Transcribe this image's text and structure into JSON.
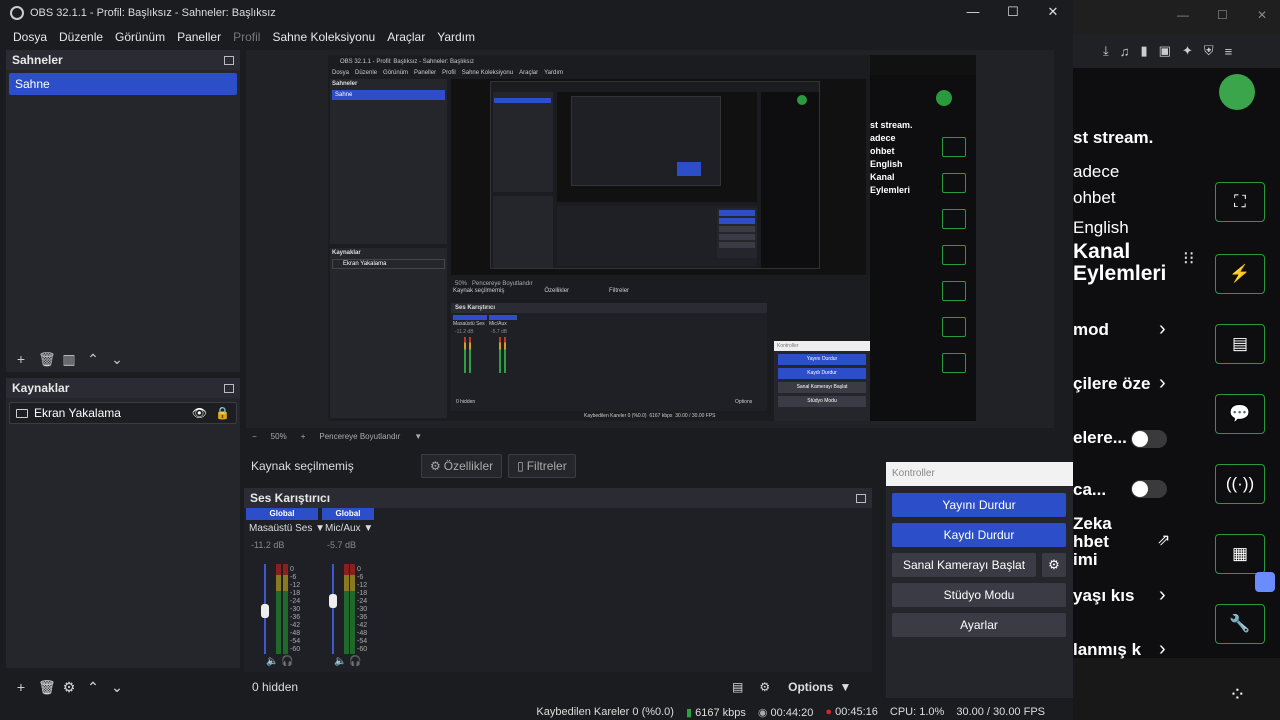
{
  "window": {
    "title": "OBS 32.1.1 - Profil: Başlıksız - Sahneler: Başlıksız",
    "min": "—",
    "max": "☐",
    "close": "✕"
  },
  "menu": [
    "Dosya",
    "Düzenle",
    "Görünüm",
    "Paneller",
    "Profil",
    "Sahne Koleksiyonu",
    "Araçlar",
    "Yardım"
  ],
  "scenes": {
    "title": "Sahneler",
    "items": [
      "Sahne"
    ]
  },
  "sources": {
    "title": "Kaynaklar",
    "items": [
      "Ekran Yakalama"
    ]
  },
  "preview": {
    "zoom": "50%",
    "fit_label": "Pencereye Boyutlandır",
    "capture_title": "OBS 32.1.1 - Profil: Başlıksız - Sahneler: Başlıksız",
    "capture_menu": [
      "Dosya",
      "Düzenle",
      "Görünüm",
      "Paneller",
      "Profil",
      "Sahne Koleksiyonu",
      "Araçlar",
      "Yardım"
    ],
    "capture_scenes": "Sahneler",
    "capture_scene": "Sahne",
    "capture_sources": "Kaynaklar",
    "capture_source": "Ekran Yakalama",
    "capture_nosel": "Kaynak seçilmemiş",
    "capture_props": "Özellikler",
    "capture_filters": "Filtreler",
    "capture_mixer": "Ses Karıştırıcı",
    "capture_controls": "Kontroller",
    "capture_ch1": "Masaüstü Ses",
    "capture_ch2": "Mic/Aux",
    "capture_db1": "-11.2 dB",
    "capture_db2": "-5.7 dB",
    "capture_hidden": "0 hidden",
    "capture_options": "Options",
    "capture_status": "Kaybedilen Kareler 0 (%0.0)",
    "capture_kbps": "6167 kbps",
    "capture_fps": "30.00 / 30.00 FPS",
    "capture_buttons": [
      "Yayını Durdur",
      "Kaydı Durdur",
      "Sanal Kamerayı Başlat",
      "Stüdyo Modu",
      "Ayarlar"
    ]
  },
  "source_toolbar": {
    "no_selection": "Kaynak seçilmemiş",
    "properties": "Özellikler",
    "filters": "Filtreler"
  },
  "mixer": {
    "title": "Ses Karıştırıcı",
    "channels": [
      {
        "badge": "Global",
        "name": "Masaüstü Ses",
        "db": "-11.2 dB",
        "level": 0.35
      },
      {
        "badge": "Global",
        "name": "Mic/Aux",
        "db": "-5.7 dB",
        "level": 0.5
      }
    ],
    "scale": [
      "0",
      "-6",
      "-12",
      "-18",
      "-24",
      "-30",
      "-36",
      "-42",
      "-48",
      "-54",
      "-60"
    ],
    "hidden": "0 hidden",
    "options": "Options"
  },
  "controls": {
    "title": "Kontroller",
    "buttons": [
      "Yayını Durdur",
      "Kaydı Durdur",
      "Sanal Kamerayı Başlat",
      "Stüdyo Modu",
      "Ayarlar"
    ]
  },
  "status": {
    "dropped": "Kaybedilen Kareler 0 (%0.0)",
    "kbps": "6167 kbps",
    "stream_time": "00:44:20",
    "rec_time": "00:45:16",
    "cpu": "CPU: 1.0%",
    "fps": "30.00 / 30.00 FPS"
  },
  "browser": {
    "chat": [
      "st stream.",
      "adece",
      "ohbet",
      "English",
      "Kanal",
      "Eylemleri",
      "mod",
      "çilere öze",
      "elere...",
      "ca...",
      "Zeka",
      "hbet",
      "imi",
      "yaşı kıs",
      "lanmış k"
    ]
  },
  "colors": {
    "accent": "#2c4fc9",
    "twitch_green": "#2b9a3e",
    "rec_red": "#d42626"
  }
}
